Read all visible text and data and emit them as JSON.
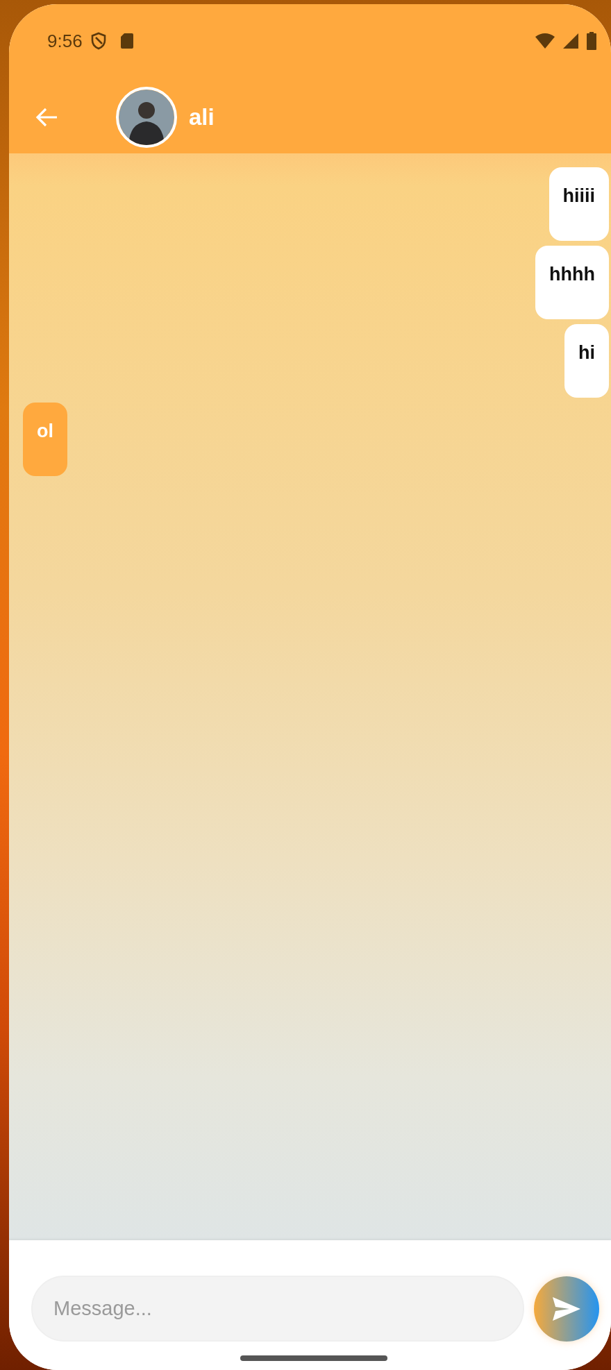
{
  "status_bar": {
    "time": "9:56"
  },
  "header": {
    "contact_name": "ali"
  },
  "messages": [
    {
      "text": "hiiii",
      "kind": "sent"
    },
    {
      "text": "hhhh",
      "kind": "sent"
    },
    {
      "text": "hi",
      "kind": "sent"
    },
    {
      "text": "ol",
      "kind": "received"
    }
  ],
  "composer": {
    "placeholder": "Message..."
  }
}
